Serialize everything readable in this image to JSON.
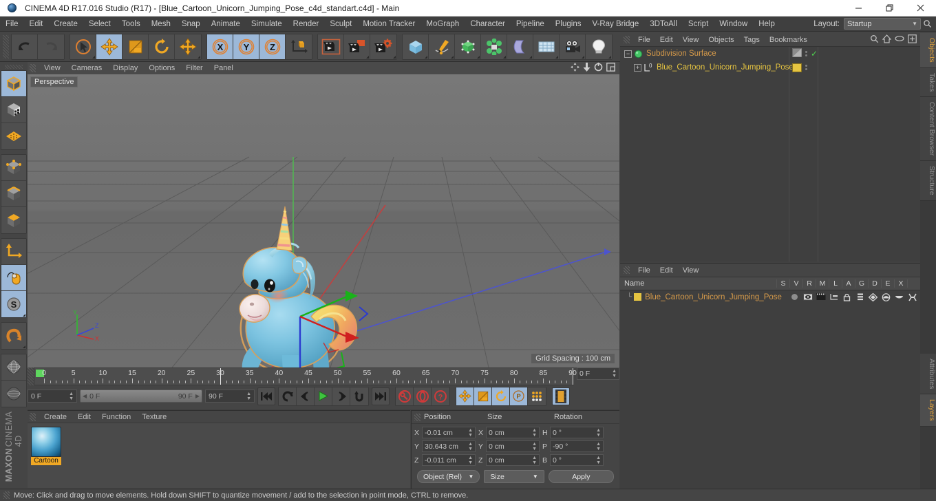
{
  "window": {
    "title": "CINEMA 4D R17.016 Studio (R17) - [Blue_Cartoon_Unicorn_Jumping_Pose_c4d_standart.c4d] - Main",
    "minimize": "—",
    "maximize": "❐",
    "close": "✕"
  },
  "menubar": {
    "items": [
      "File",
      "Edit",
      "Create",
      "Select",
      "Tools",
      "Mesh",
      "Snap",
      "Animate",
      "Simulate",
      "Render",
      "Sculpt",
      "Motion Tracker",
      "MoGraph",
      "Character",
      "Pipeline",
      "Plugins",
      "V-Ray Bridge",
      "3DToAll",
      "Script",
      "Window",
      "Help"
    ],
    "layout_label": "Layout:",
    "layout_value": "Startup",
    "chevron": "▼"
  },
  "toolbar": {
    "groups": [
      {
        "name": "history",
        "buttons": [
          {
            "name": "undo-button",
            "icon": "undo-icon",
            "selected": false
          },
          {
            "name": "redo-button",
            "icon": "redo-icon",
            "selected": false
          }
        ]
      },
      {
        "name": "tools",
        "buttons": [
          {
            "name": "live-selection-tool",
            "icon": "cursor-circle-icon",
            "selected": false
          },
          {
            "name": "move-tool",
            "icon": "move-arrows-icon",
            "selected": true
          },
          {
            "name": "scale-tool",
            "icon": "scale-box-icon",
            "selected": false
          },
          {
            "name": "rotate-tool",
            "icon": "rotate-icon",
            "selected": false
          },
          {
            "name": "move-alt-tool",
            "icon": "move-arrows-icon",
            "selected": false
          }
        ]
      },
      {
        "name": "axis-locks",
        "buttons": [
          {
            "name": "x-axis-lock",
            "icon": "x-axis-icon",
            "selected": true
          },
          {
            "name": "y-axis-lock",
            "icon": "y-axis-icon",
            "selected": true
          },
          {
            "name": "z-axis-lock",
            "icon": "z-axis-icon",
            "selected": true
          },
          {
            "name": "world-coordinates",
            "icon": "world-axis-icon",
            "selected": false
          }
        ]
      },
      {
        "name": "render",
        "buttons": [
          {
            "name": "render-view-button",
            "icon": "clapper-icon",
            "selected": false
          },
          {
            "name": "render-to-picture-viewer",
            "icon": "clapper-picture-icon",
            "selected": false
          },
          {
            "name": "render-settings-button",
            "icon": "clapper-gear-icon",
            "selected": false
          }
        ]
      },
      {
        "name": "creation",
        "buttons": [
          {
            "name": "add-cube-button",
            "icon": "cube-icon",
            "selected": false
          },
          {
            "name": "add-spline-button",
            "icon": "pen-icon",
            "selected": false
          },
          {
            "name": "add-generator-button",
            "icon": "green-cube-icon",
            "selected": false
          },
          {
            "name": "add-array-button",
            "icon": "cluster-icon",
            "selected": false
          },
          {
            "name": "add-deformer-button",
            "icon": "bend-icon",
            "selected": false
          },
          {
            "name": "add-environment-button",
            "icon": "floor-grid-icon",
            "selected": false
          },
          {
            "name": "add-camera-button",
            "icon": "camera-icon",
            "selected": false
          },
          {
            "name": "add-light-button",
            "icon": "light-bulb-icon",
            "selected": false
          }
        ]
      }
    ]
  },
  "lefttools": {
    "groups": [
      {
        "buttons": [
          {
            "name": "model-mode-button",
            "icon": "model-cube-icon",
            "selected": true
          },
          {
            "name": "texture-mode-button",
            "icon": "texture-cube-icon",
            "selected": false
          },
          {
            "name": "workplane-mode-button",
            "icon": "workplane-grid-icon",
            "selected": false
          }
        ]
      },
      {
        "buttons": [
          {
            "name": "points-mode-button",
            "icon": "points-cube-icon",
            "selected": false
          },
          {
            "name": "edges-mode-button",
            "icon": "edges-cube-icon",
            "selected": false
          },
          {
            "name": "polygons-mode-button",
            "icon": "polygons-cube-icon",
            "selected": false
          }
        ]
      },
      {
        "buttons": [
          {
            "name": "object-axis-button",
            "icon": "axis-corner-icon",
            "selected": false
          },
          {
            "name": "enable-axis-button",
            "icon": "mouse-axis-icon",
            "selected": true
          },
          {
            "name": "soft-selection-button",
            "icon": "s-circle-icon",
            "selected": true
          }
        ]
      },
      {
        "buttons": [
          {
            "name": "snap-magnet-button",
            "icon": "magnet-icon",
            "selected": false
          }
        ]
      },
      {
        "buttons": [
          {
            "name": "viewport-solo-button",
            "icon": "grid-sphere-icon",
            "selected": false
          },
          {
            "name": "viewport-layer-button",
            "icon": "layers-sphere-icon",
            "selected": false
          }
        ]
      }
    ],
    "brand_bold": "MAXON",
    "brand_light": "CINEMA 4D"
  },
  "viewport": {
    "menus": [
      "View",
      "Cameras",
      "Display",
      "Options",
      "Filter",
      "Panel"
    ],
    "nav_icons": [
      "pan-icon",
      "zoom-icon",
      "rotate-view-icon",
      "maximize-view-icon"
    ],
    "label": "Perspective",
    "grid_spacing": "Grid Spacing : 100 cm",
    "axis_gizmo": {
      "y": "Y",
      "z": "Z",
      "x": "X"
    },
    "model": {
      "name": "Blue Cartoon Unicorn Jumping Pose",
      "body_color": "#7cc3e0",
      "hoof_color": "#2d7f8e",
      "mane_color": "#a9dcea",
      "blush_color": "#f2a08f",
      "horn_colors": [
        "#f2a0a0",
        "#f7d07a",
        "#a8dfa0",
        "#8fc7e8"
      ],
      "outline_color": "#d9a05a"
    }
  },
  "timeline": {
    "tick_labels": [
      0,
      5,
      10,
      15,
      20,
      25,
      30,
      35,
      40,
      45,
      50,
      55,
      60,
      65,
      70,
      75,
      80,
      85,
      90
    ],
    "min_frame": 0,
    "max_frame": 90,
    "current_frame_label": "0 F",
    "range_start_label": "0 F",
    "range_end_label": "90 F",
    "end_frame_label": "90 F",
    "preview_frame_label": "0 F",
    "transport": [
      {
        "name": "go-to-start-button",
        "icon": "skip-start-icon"
      },
      {
        "name": "play-backwards-button",
        "icon": "loop-icon"
      },
      {
        "name": "step-back-button",
        "icon": "prev-frame-icon"
      },
      {
        "name": "play-button",
        "icon": "play-icon"
      },
      {
        "name": "step-forward-button",
        "icon": "next-frame-icon"
      },
      {
        "name": "loop-button",
        "icon": "return-icon"
      },
      {
        "name": "go-to-end-button",
        "icon": "skip-end-icon"
      }
    ],
    "keyframe_buttons": [
      {
        "name": "record-keyframe-button",
        "icon": "key-icon"
      },
      {
        "name": "autokey-button",
        "icon": "autokey-icon"
      },
      {
        "name": "keyframe-selection-button",
        "icon": "question-icon"
      }
    ],
    "record_toggles": [
      {
        "name": "record-position-button",
        "icon": "move-arrows-icon",
        "selected": true
      },
      {
        "name": "record-scale-button",
        "icon": "scale-box-icon",
        "selected": true
      },
      {
        "name": "record-rotation-button",
        "icon": "rotate-icon",
        "selected": true
      },
      {
        "name": "record-parameter-button",
        "icon": "p-circle-icon",
        "selected": true
      },
      {
        "name": "record-pla-button",
        "icon": "point-grid-icon",
        "selected": false
      }
    ],
    "filmstrip_button": {
      "name": "animation-mode-button",
      "icon": "filmstrip-icon",
      "selected": true
    }
  },
  "material_manager": {
    "menus": [
      "Create",
      "Edit",
      "Function",
      "Texture"
    ],
    "materials": [
      {
        "name": "Cartoon",
        "selected": true
      }
    ]
  },
  "coordinates": {
    "headers": [
      "Position",
      "Size",
      "Rotation"
    ],
    "rows": [
      {
        "pos_axis": "X",
        "pos_value": "-0.01 cm",
        "size_axis": "X",
        "size_value": "0 cm",
        "rot_axis": "H",
        "rot_value": "0 °"
      },
      {
        "pos_axis": "Y",
        "pos_value": "30.643 cm",
        "size_axis": "Y",
        "size_value": "0 cm",
        "rot_axis": "P",
        "rot_value": "-90 °"
      },
      {
        "pos_axis": "Z",
        "pos_value": "-0.011 cm",
        "size_axis": "Z",
        "size_value": "0 cm",
        "rot_axis": "B",
        "rot_value": "0 °"
      }
    ],
    "mode_dropdown": "Object (Rel)",
    "size_dropdown": "Size",
    "apply_button": "Apply",
    "chevron": "▼"
  },
  "object_manager": {
    "menus": [
      "File",
      "Edit",
      "View",
      "Objects",
      "Tags",
      "Bookmarks"
    ],
    "right_icons": [
      "search-icon",
      "home-icon",
      "eye-icon",
      "plus-box-icon"
    ],
    "items": [
      {
        "name": "Subdivision Surface",
        "color_class": "amber",
        "indent": 0,
        "tag_color": "none",
        "has_check": true,
        "check": "✓"
      },
      {
        "name": "Blue_Cartoon_Unicorn_Jumping_Pose",
        "color_class": "yellow",
        "indent": 1,
        "tag_color": "#e5c441",
        "has_check": false,
        "layer_num": "0"
      }
    ]
  },
  "layer_manager": {
    "menus": [
      "File",
      "Edit",
      "View"
    ],
    "name_header": "Name",
    "columns": [
      "S",
      "V",
      "R",
      "M",
      "L",
      "A",
      "G",
      "D",
      "E",
      "X"
    ],
    "rows": [
      {
        "name": "Blue_Cartoon_Unicorn_Jumping_Pose",
        "swatch": "#e5c441",
        "icons": [
          "solo-dot-icon",
          "visible-eye-icon",
          "render-clapper-icon",
          "manager-tree-icon",
          "lock-icon",
          "animation-bars-icon",
          "generator-icon",
          "deformer-icon",
          "expression-icon",
          "xref-icon"
        ]
      }
    ]
  },
  "vertical_tabs": {
    "top": [
      {
        "label": "Objects",
        "active": true
      },
      {
        "label": "Takes",
        "active": false
      },
      {
        "label": "Content Browser",
        "active": false
      },
      {
        "label": "Structure",
        "active": false
      }
    ],
    "bottom": [
      {
        "label": "Attributes",
        "active": false
      },
      {
        "label": "Layers",
        "active": true
      }
    ]
  },
  "statusbar": {
    "text": "Move: Click and drag to move elements. Hold down SHIFT to quantize movement / add to the selection in point mode, CTRL to remove."
  }
}
